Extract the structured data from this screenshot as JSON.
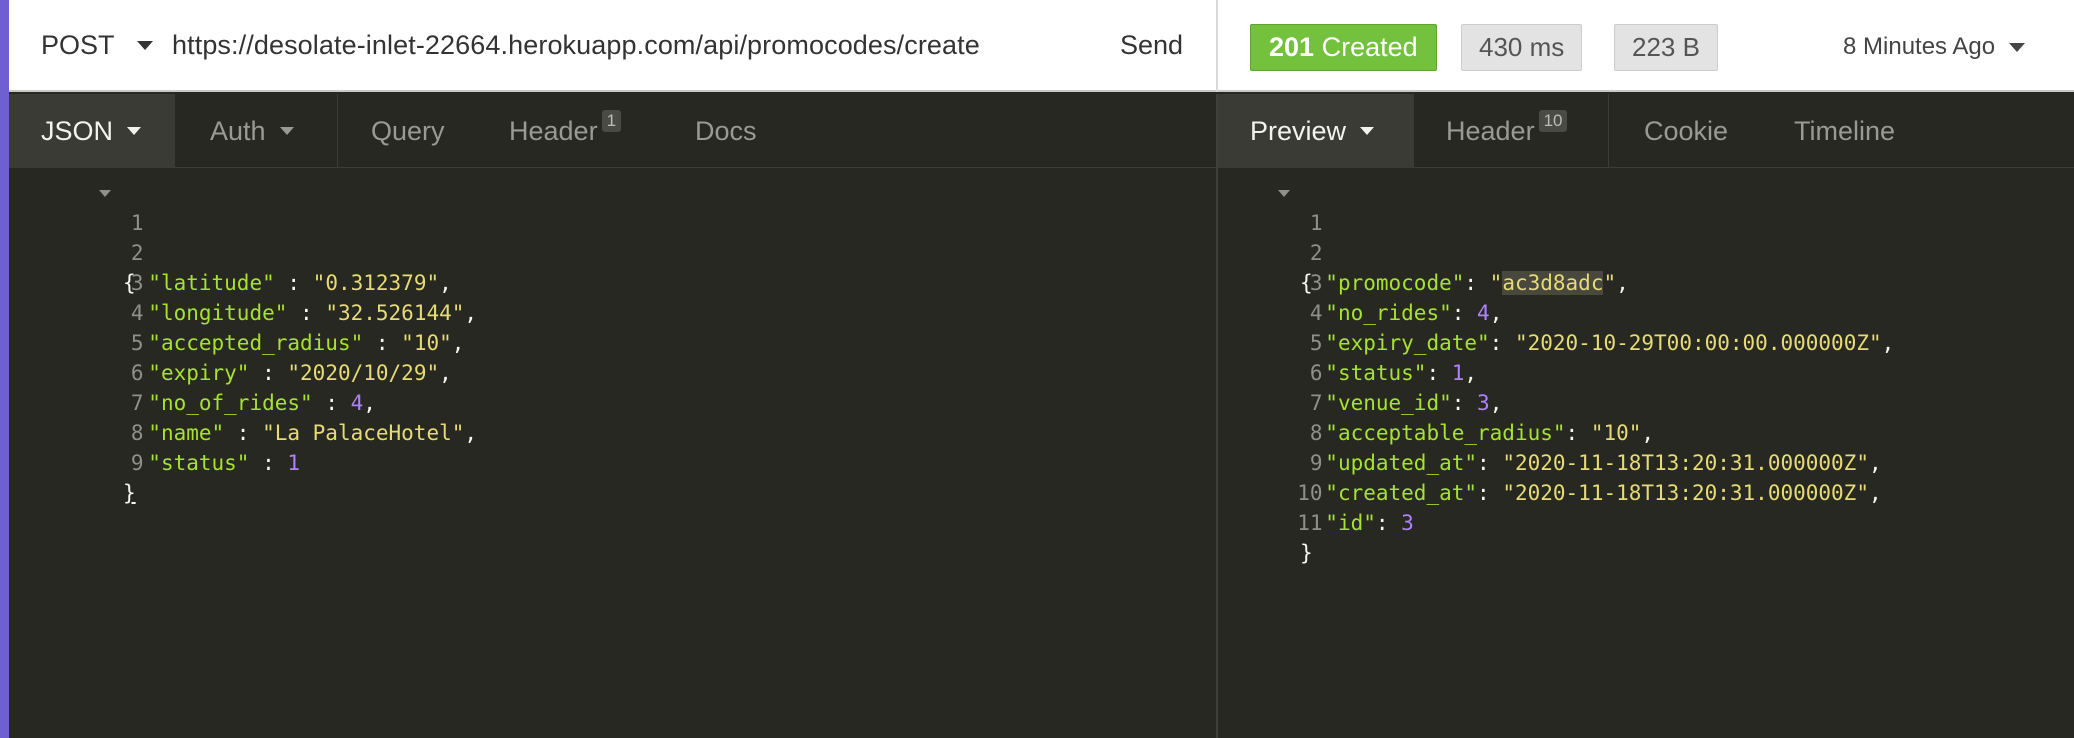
{
  "request": {
    "method": "POST",
    "url": "https://desolate-inlet-22664.herokuapp.com/api/promocodes/create",
    "send_label": "Send"
  },
  "response_meta": {
    "status_code": "201",
    "status_text": "Created",
    "time": "430 ms",
    "size": "223 B",
    "ago": "8 Minutes Ago",
    "status_color": "#73c13c"
  },
  "request_tabs": [
    {
      "label": "JSON",
      "active": true
    },
    {
      "label": "Auth"
    },
    {
      "label": "Query"
    },
    {
      "label": "Header",
      "count": "1"
    },
    {
      "label": "Docs"
    }
  ],
  "response_tabs": [
    {
      "label": "Preview",
      "active": true
    },
    {
      "label": "Header",
      "count": "10"
    },
    {
      "label": "Cookie"
    },
    {
      "label": "Timeline"
    }
  ],
  "request_body": {
    "line_numbers": [
      "1",
      "2",
      "3",
      "4",
      "5",
      "6",
      "7",
      "8",
      "9"
    ],
    "open_brace": "{",
    "close_brace": "}",
    "fields": [
      {
        "key": "\"latitude\"",
        "sep": " : ",
        "value": "\"0.312379\"",
        "end": ","
      },
      {
        "key": "\"longitude\"",
        "sep": " : ",
        "value": "\"32.526144\"",
        "end": ","
      },
      {
        "key": "\"accepted_radius\"",
        "sep": " : ",
        "value": "\"10\"",
        "end": ","
      },
      {
        "key": "\"expiry\"",
        "sep": " : ",
        "value": "\"2020/10/29\"",
        "end": ","
      },
      {
        "key": "\"no_of_rides\"",
        "sep": " : ",
        "value": "4",
        "end": ","
      },
      {
        "key": "\"name\"",
        "sep": " : ",
        "value": "\"La PalaceHotel\"",
        "end": ","
      },
      {
        "key": "\"status\"",
        "sep": " : ",
        "value": "1",
        "end": ""
      }
    ]
  },
  "response_body": {
    "line_numbers": [
      "1",
      "2",
      "3",
      "4",
      "5",
      "6",
      "7",
      "8",
      "9",
      "10",
      "11"
    ],
    "open_brace": "{",
    "close_brace": "}",
    "promocode_key": "\"promocode\"",
    "promocode_sep": ": ",
    "promocode_quote_open": "\"",
    "promocode_value": "ac3d8adc",
    "promocode_quote_close": "\"",
    "promocode_end": ",",
    "fields": [
      {
        "key": "\"no_rides\"",
        "sep": ": ",
        "value": "4",
        "end": ","
      },
      {
        "key": "\"expiry_date\"",
        "sep": ": ",
        "value": "\"2020-10-29T00:00:00.000000Z\"",
        "end": ","
      },
      {
        "key": "\"status\"",
        "sep": ": ",
        "value": "1",
        "end": ","
      },
      {
        "key": "\"venue_id\"",
        "sep": ": ",
        "value": "3",
        "end": ","
      },
      {
        "key": "\"acceptable_radius\"",
        "sep": ": ",
        "value": "\"10\"",
        "end": ","
      },
      {
        "key": "\"updated_at\"",
        "sep": ": ",
        "value": "\"2020-11-18T13:20:31.000000Z\"",
        "end": ","
      },
      {
        "key": "\"created_at\"",
        "sep": ": ",
        "value": "\"2020-11-18T13:20:31.000000Z\"",
        "end": ","
      },
      {
        "key": "\"id\"",
        "sep": ": ",
        "value": "3",
        "end": ""
      }
    ]
  },
  "icons": [
    "dropdown-caret-icon",
    "fold-arrow-icon"
  ]
}
